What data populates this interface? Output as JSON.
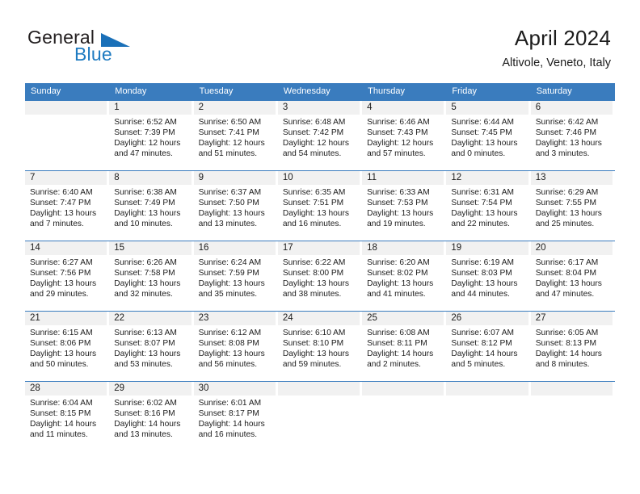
{
  "brand": {
    "name_part1": "General",
    "name_part2": "Blue",
    "logo_mark": "triangle-flag",
    "color_primary": "#1a70b8",
    "color_text": "#231f20"
  },
  "header": {
    "title": "April 2024",
    "subtitle": "Altivole, Veneto, Italy"
  },
  "theme": {
    "header_blue": "#3a7cbe",
    "daynum_bg": "#f1f1f1",
    "text": "#1c1c1c"
  },
  "weekdays": [
    "Sunday",
    "Monday",
    "Tuesday",
    "Wednesday",
    "Thursday",
    "Friday",
    "Saturday"
  ],
  "weeks": [
    [
      {
        "day": "",
        "lines": [
          "",
          "",
          "",
          ""
        ]
      },
      {
        "day": "1",
        "lines": [
          "Sunrise: 6:52 AM",
          "Sunset: 7:39 PM",
          "Daylight: 12 hours",
          "and 47 minutes."
        ]
      },
      {
        "day": "2",
        "lines": [
          "Sunrise: 6:50 AM",
          "Sunset: 7:41 PM",
          "Daylight: 12 hours",
          "and 51 minutes."
        ]
      },
      {
        "day": "3",
        "lines": [
          "Sunrise: 6:48 AM",
          "Sunset: 7:42 PM",
          "Daylight: 12 hours",
          "and 54 minutes."
        ]
      },
      {
        "day": "4",
        "lines": [
          "Sunrise: 6:46 AM",
          "Sunset: 7:43 PM",
          "Daylight: 12 hours",
          "and 57 minutes."
        ]
      },
      {
        "day": "5",
        "lines": [
          "Sunrise: 6:44 AM",
          "Sunset: 7:45 PM",
          "Daylight: 13 hours",
          "and 0 minutes."
        ]
      },
      {
        "day": "6",
        "lines": [
          "Sunrise: 6:42 AM",
          "Sunset: 7:46 PM",
          "Daylight: 13 hours",
          "and 3 minutes."
        ]
      }
    ],
    [
      {
        "day": "7",
        "lines": [
          "Sunrise: 6:40 AM",
          "Sunset: 7:47 PM",
          "Daylight: 13 hours",
          "and 7 minutes."
        ]
      },
      {
        "day": "8",
        "lines": [
          "Sunrise: 6:38 AM",
          "Sunset: 7:49 PM",
          "Daylight: 13 hours",
          "and 10 minutes."
        ]
      },
      {
        "day": "9",
        "lines": [
          "Sunrise: 6:37 AM",
          "Sunset: 7:50 PM",
          "Daylight: 13 hours",
          "and 13 minutes."
        ]
      },
      {
        "day": "10",
        "lines": [
          "Sunrise: 6:35 AM",
          "Sunset: 7:51 PM",
          "Daylight: 13 hours",
          "and 16 minutes."
        ]
      },
      {
        "day": "11",
        "lines": [
          "Sunrise: 6:33 AM",
          "Sunset: 7:53 PM",
          "Daylight: 13 hours",
          "and 19 minutes."
        ]
      },
      {
        "day": "12",
        "lines": [
          "Sunrise: 6:31 AM",
          "Sunset: 7:54 PM",
          "Daylight: 13 hours",
          "and 22 minutes."
        ]
      },
      {
        "day": "13",
        "lines": [
          "Sunrise: 6:29 AM",
          "Sunset: 7:55 PM",
          "Daylight: 13 hours",
          "and 25 minutes."
        ]
      }
    ],
    [
      {
        "day": "14",
        "lines": [
          "Sunrise: 6:27 AM",
          "Sunset: 7:56 PM",
          "Daylight: 13 hours",
          "and 29 minutes."
        ]
      },
      {
        "day": "15",
        "lines": [
          "Sunrise: 6:26 AM",
          "Sunset: 7:58 PM",
          "Daylight: 13 hours",
          "and 32 minutes."
        ]
      },
      {
        "day": "16",
        "lines": [
          "Sunrise: 6:24 AM",
          "Sunset: 7:59 PM",
          "Daylight: 13 hours",
          "and 35 minutes."
        ]
      },
      {
        "day": "17",
        "lines": [
          "Sunrise: 6:22 AM",
          "Sunset: 8:00 PM",
          "Daylight: 13 hours",
          "and 38 minutes."
        ]
      },
      {
        "day": "18",
        "lines": [
          "Sunrise: 6:20 AM",
          "Sunset: 8:02 PM",
          "Daylight: 13 hours",
          "and 41 minutes."
        ]
      },
      {
        "day": "19",
        "lines": [
          "Sunrise: 6:19 AM",
          "Sunset: 8:03 PM",
          "Daylight: 13 hours",
          "and 44 minutes."
        ]
      },
      {
        "day": "20",
        "lines": [
          "Sunrise: 6:17 AM",
          "Sunset: 8:04 PM",
          "Daylight: 13 hours",
          "and 47 minutes."
        ]
      }
    ],
    [
      {
        "day": "21",
        "lines": [
          "Sunrise: 6:15 AM",
          "Sunset: 8:06 PM",
          "Daylight: 13 hours",
          "and 50 minutes."
        ]
      },
      {
        "day": "22",
        "lines": [
          "Sunrise: 6:13 AM",
          "Sunset: 8:07 PM",
          "Daylight: 13 hours",
          "and 53 minutes."
        ]
      },
      {
        "day": "23",
        "lines": [
          "Sunrise: 6:12 AM",
          "Sunset: 8:08 PM",
          "Daylight: 13 hours",
          "and 56 minutes."
        ]
      },
      {
        "day": "24",
        "lines": [
          "Sunrise: 6:10 AM",
          "Sunset: 8:10 PM",
          "Daylight: 13 hours",
          "and 59 minutes."
        ]
      },
      {
        "day": "25",
        "lines": [
          "Sunrise: 6:08 AM",
          "Sunset: 8:11 PM",
          "Daylight: 14 hours",
          "and 2 minutes."
        ]
      },
      {
        "day": "26",
        "lines": [
          "Sunrise: 6:07 AM",
          "Sunset: 8:12 PM",
          "Daylight: 14 hours",
          "and 5 minutes."
        ]
      },
      {
        "day": "27",
        "lines": [
          "Sunrise: 6:05 AM",
          "Sunset: 8:13 PM",
          "Daylight: 14 hours",
          "and 8 minutes."
        ]
      }
    ],
    [
      {
        "day": "28",
        "lines": [
          "Sunrise: 6:04 AM",
          "Sunset: 8:15 PM",
          "Daylight: 14 hours",
          "and 11 minutes."
        ]
      },
      {
        "day": "29",
        "lines": [
          "Sunrise: 6:02 AM",
          "Sunset: 8:16 PM",
          "Daylight: 14 hours",
          "and 13 minutes."
        ]
      },
      {
        "day": "30",
        "lines": [
          "Sunrise: 6:01 AM",
          "Sunset: 8:17 PM",
          "Daylight: 14 hours",
          "and 16 minutes."
        ]
      },
      {
        "day": "",
        "lines": [
          "",
          "",
          "",
          ""
        ]
      },
      {
        "day": "",
        "lines": [
          "",
          "",
          "",
          ""
        ]
      },
      {
        "day": "",
        "lines": [
          "",
          "",
          "",
          ""
        ]
      },
      {
        "day": "",
        "lines": [
          "",
          "",
          "",
          ""
        ]
      }
    ]
  ]
}
